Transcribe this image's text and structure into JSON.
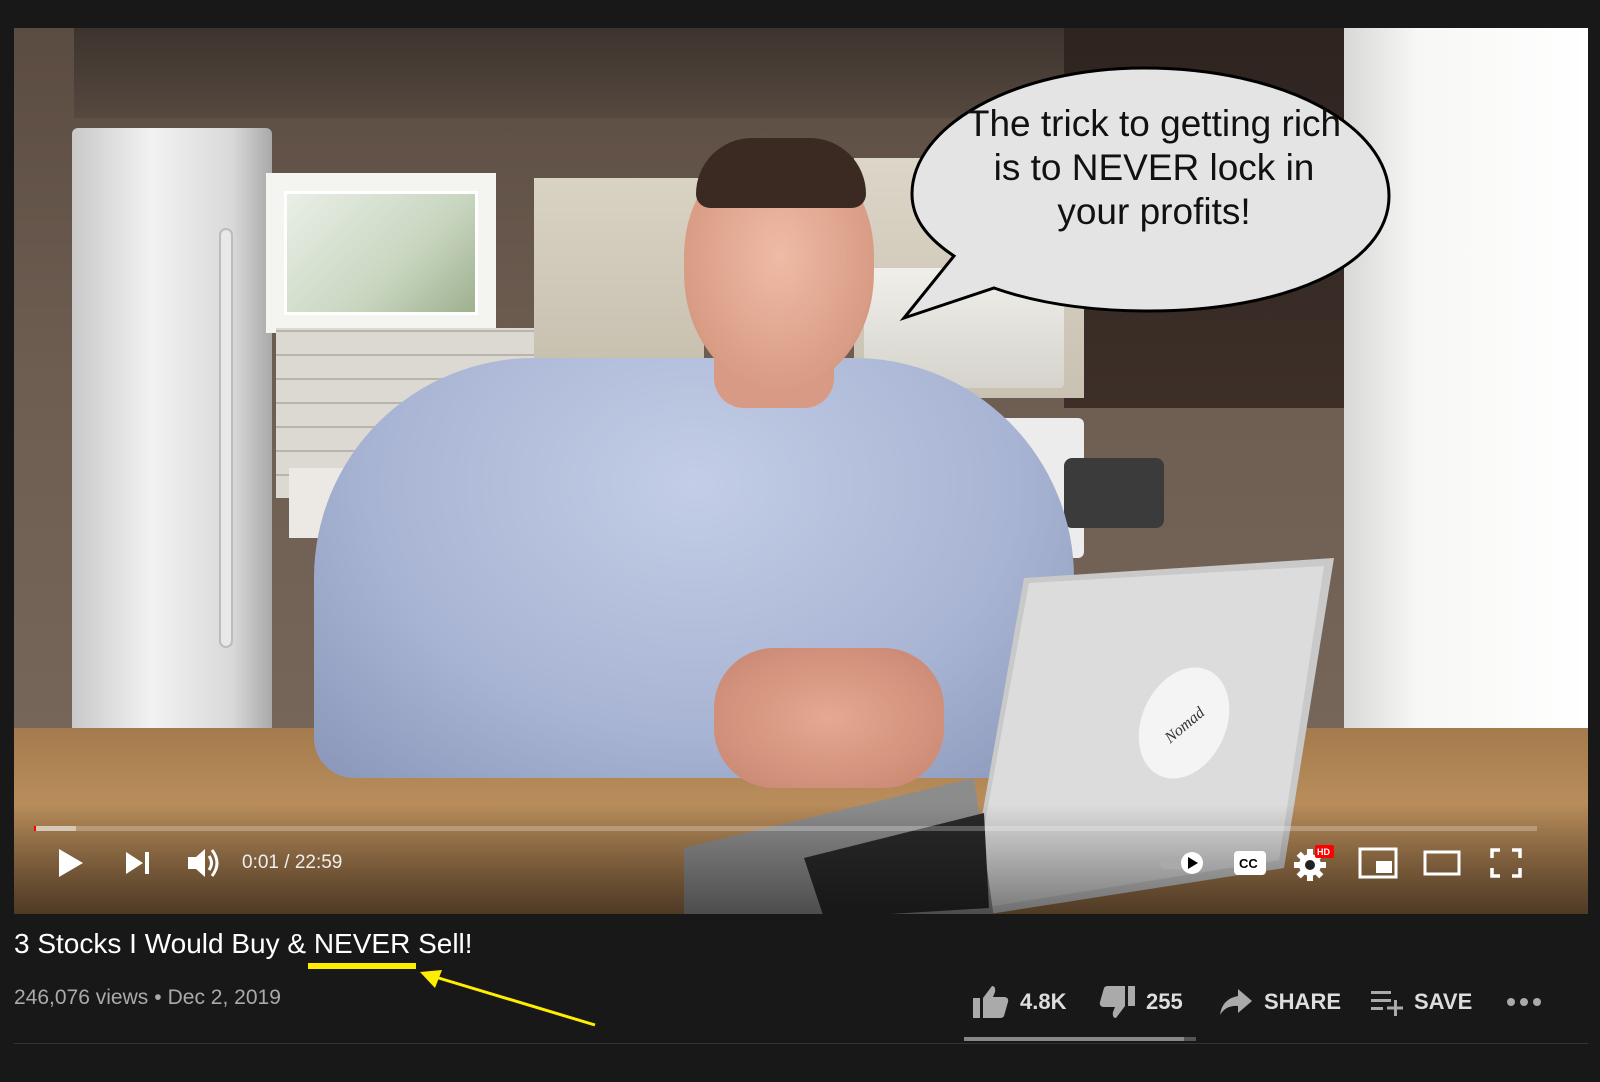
{
  "video": {
    "speech_bubble": "The trick to getting rich is to NEVER lock in your profits!",
    "current_time": "0:01",
    "duration": "22:59",
    "time_separator": " / ",
    "progress_fraction": 0.001,
    "buffered_fraction": 0.028,
    "hd_badge": "HD",
    "sticker_text": "Nomad"
  },
  "controls": {
    "left": [
      "play-icon",
      "next-icon",
      "volume-icon"
    ],
    "right": [
      "autoplay-toggle-icon",
      "captions-icon",
      "settings-icon",
      "miniplayer-icon",
      "theater-mode-icon",
      "fullscreen-icon"
    ]
  },
  "info": {
    "title": "3 Stocks I Would Buy & NEVER Sell!",
    "views": "246,076 views",
    "date": "Dec 2, 2019",
    "likes": "4.8K",
    "dislikes": "255",
    "share_label": "SHARE",
    "save_label": "SAVE",
    "like_ratio": 0.95
  },
  "annotation": {
    "underline_color": "#ffee00",
    "arrow_color": "#ffee00"
  }
}
